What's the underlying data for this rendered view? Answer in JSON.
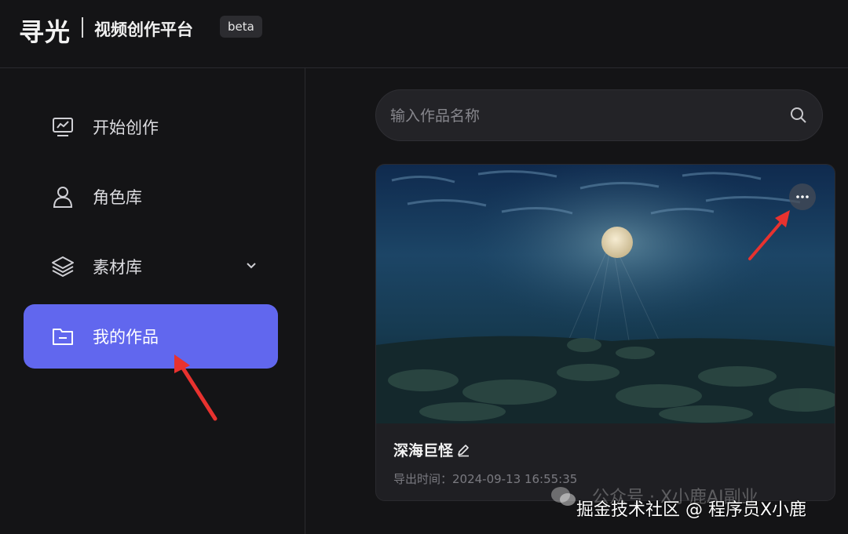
{
  "header": {
    "logo": "寻光",
    "platform_title": "视频创作平台",
    "badge": "beta"
  },
  "sidebar": {
    "items": [
      {
        "label": "开始创作",
        "icon": "monitor-chart-icon",
        "active": false
      },
      {
        "label": "角色库",
        "icon": "person-icon",
        "active": false
      },
      {
        "label": "素材库",
        "icon": "layers-icon",
        "active": false,
        "expandable": true
      },
      {
        "label": "我的作品",
        "icon": "folder-icon",
        "active": true
      }
    ]
  },
  "search": {
    "placeholder": "输入作品名称",
    "icon": "search-icon"
  },
  "works": [
    {
      "title": "深海巨怪",
      "export_time": "导出时间：2024-09-13 16:55:35",
      "thumbnail": "underwater moonlit scene"
    }
  ],
  "watermark": {
    "back_text": "公众号 · X小鹿AI副业",
    "front_text": "掘金技术社区 @ 程序员X小鹿"
  },
  "colors": {
    "accent": "#6167ee",
    "background": "#141416",
    "annotation_arrow": "#e8322f"
  }
}
